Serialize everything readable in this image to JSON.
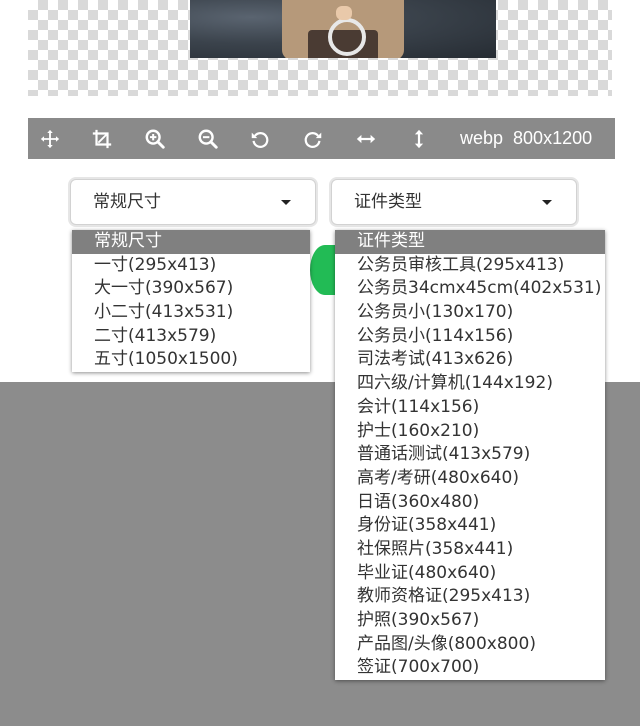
{
  "toolbar": {
    "tools": [
      {
        "icon": "move-icon"
      },
      {
        "icon": "crop-icon"
      },
      {
        "icon": "zoom-in-icon"
      },
      {
        "icon": "zoom-out-icon"
      },
      {
        "icon": "rotate-left-icon"
      },
      {
        "icon": "rotate-right-icon"
      },
      {
        "icon": "flip-horizontal-icon"
      },
      {
        "icon": "flip-vertical-icon"
      }
    ],
    "format": "webp",
    "dimensions": "800x1200"
  },
  "size_select": {
    "value": "常规尺寸",
    "options": [
      "常规尺寸",
      "一寸(295x413)",
      "大一寸(390x567)",
      "小二寸(413x531)",
      "二寸(413x579)",
      "五寸(1050x1500)"
    ]
  },
  "type_select": {
    "value": "证件类型",
    "options": [
      "证件类型",
      "公务员审核工具(295x413)",
      "公务员34cmx45cm(402x531)",
      "公务员小(130x170)",
      "公务员小(114x156)",
      "司法考试(413x626)",
      "四六级/计算机(144x192)",
      "会计(114x156)",
      "护士(160x210)",
      "普通话测试(413x579)",
      "高考/考研(480x640)",
      "日语(360x480)",
      "身份证(358x441)",
      "社保照片(358x441)",
      "毕业证(480x640)",
      "教师资格证(295x413)",
      "护照(390x567)",
      "产品图/头像(800x800)",
      "签证(700x700)"
    ]
  },
  "colors": {
    "toolbar_bg": "#8a8a8a",
    "selected_option_bg": "#808080",
    "accent_green": "#22bb55",
    "page_bg": "#8c8c8c"
  }
}
